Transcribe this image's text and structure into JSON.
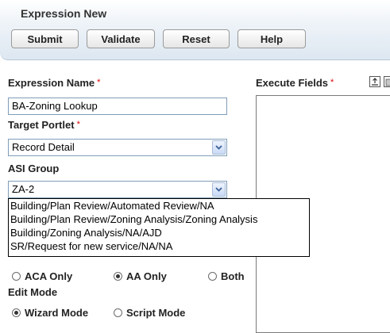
{
  "header": {
    "title": "Expression New",
    "buttons": {
      "submit": "Submit",
      "validate": "Validate",
      "reset": "Reset",
      "help": "Help"
    }
  },
  "form": {
    "expression_name": {
      "label": "Expression Name",
      "required": "*",
      "value": "BA-Zoning Lookup"
    },
    "target_portlet": {
      "label": "Target Portlet",
      "required": "*",
      "value": "Record Detail"
    },
    "asi_group": {
      "label": "ASI Group",
      "value": "ZA-2",
      "options": [
        "Building/Plan Review/Automated Review/NA",
        "Building/Plan Review/Zoning Analysis/Zoning Analysis",
        "Building/Zoning Analysis/NA/AJD",
        "SR/Request for new service/NA/NA"
      ]
    },
    "portal_type": {
      "options": [
        {
          "label": "ACA Only",
          "selected": false
        },
        {
          "label": "AA Only",
          "selected": true
        },
        {
          "label": "Both",
          "selected": false
        }
      ]
    },
    "edit_mode": {
      "label": "Edit Mode",
      "options": [
        {
          "label": "Wizard Mode",
          "selected": true
        },
        {
          "label": "Script Mode",
          "selected": false
        }
      ]
    }
  },
  "execute_fields": {
    "label": "Execute Fields",
    "required": "*"
  }
}
